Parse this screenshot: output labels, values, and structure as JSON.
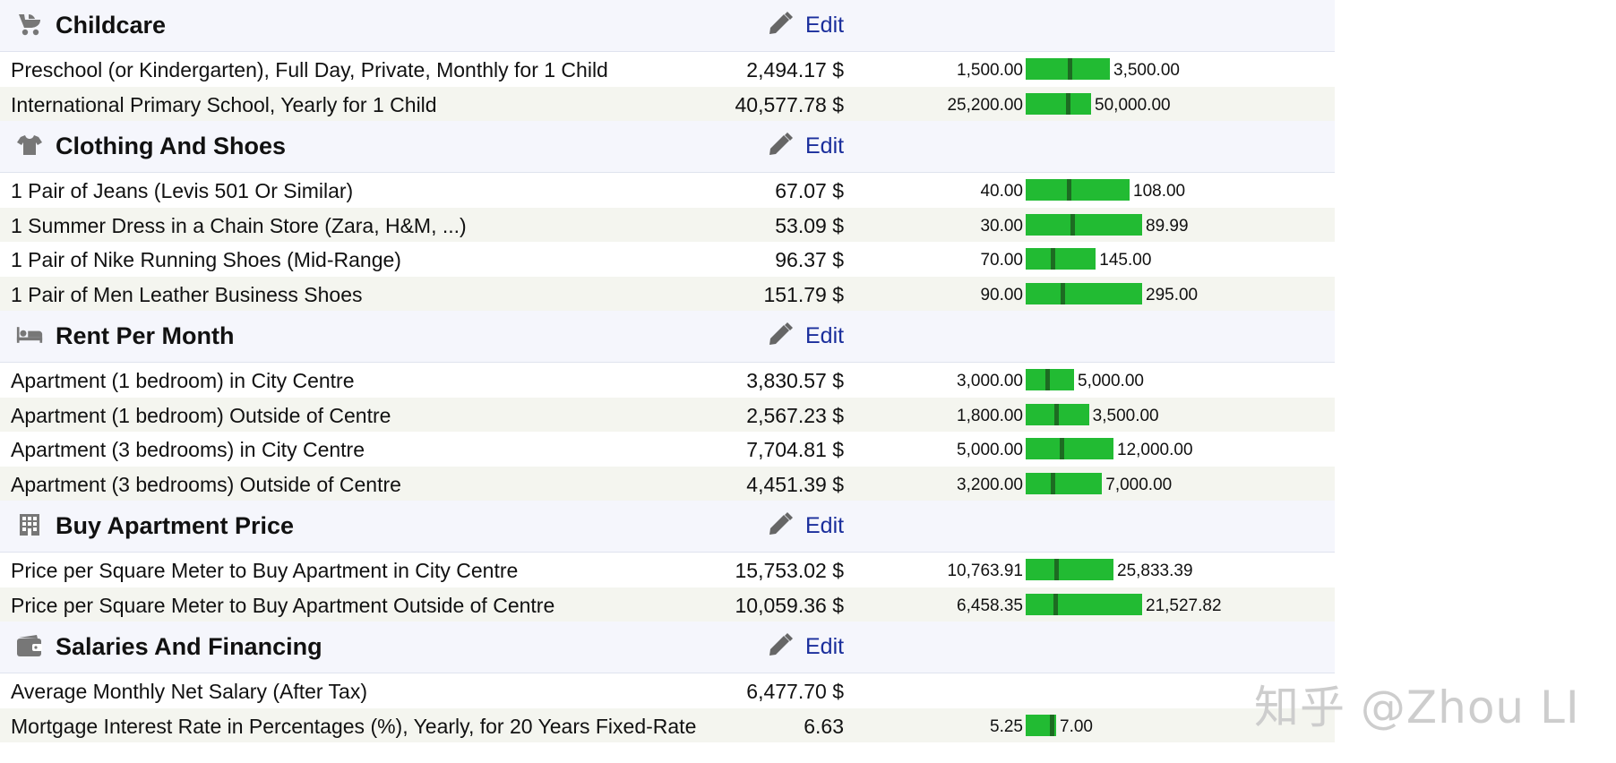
{
  "categories": [
    {
      "key": "childcare",
      "title": "Childcare",
      "icon": "stroller-icon",
      "edit_label": "Edit",
      "items": [
        {
          "name": "Preschool (or Kindergarten), Full Day, Private, Monthly for 1 Child",
          "price": "2,494.17 $",
          "min": "1,500.00",
          "max": "3,500.00",
          "min_v": 1500,
          "max_v": 3500,
          "v": 2494.17
        },
        {
          "name": "International Primary School, Yearly for 1 Child",
          "price": "40,577.78 $",
          "min": "25,200.00",
          "max": "50,000.00",
          "min_v": 25200,
          "max_v": 50000,
          "v": 40577.78
        }
      ]
    },
    {
      "key": "clothing",
      "title": "Clothing And Shoes",
      "icon": "tshirt-icon",
      "edit_label": "Edit",
      "items": [
        {
          "name": "1 Pair of Jeans (Levis 501 Or Similar)",
          "price": "67.07 $",
          "min": "40.00",
          "max": "108.00",
          "min_v": 40,
          "max_v": 108,
          "v": 67.07
        },
        {
          "name": "1 Summer Dress in a Chain Store (Zara, H&M, ...)",
          "price": "53.09 $",
          "min": "30.00",
          "max": "89.99",
          "min_v": 30,
          "max_v": 89.99,
          "v": 53.09
        },
        {
          "name": "1 Pair of Nike Running Shoes (Mid-Range)",
          "price": "96.37 $",
          "min": "70.00",
          "max": "145.00",
          "min_v": 70,
          "max_v": 145,
          "v": 96.37
        },
        {
          "name": "1 Pair of Men Leather Business Shoes",
          "price": "151.79 $",
          "min": "90.00",
          "max": "295.00",
          "min_v": 90,
          "max_v": 295,
          "v": 151.79
        }
      ]
    },
    {
      "key": "rent",
      "title": "Rent Per Month",
      "icon": "bed-icon",
      "edit_label": "Edit",
      "items": [
        {
          "name": "Apartment (1 bedroom) in City Centre",
          "price": "3,830.57 $",
          "min": "3,000.00",
          "max": "5,000.00",
          "min_v": 3000,
          "max_v": 5000,
          "v": 3830.57
        },
        {
          "name": "Apartment (1 bedroom) Outside of Centre",
          "price": "2,567.23 $",
          "min": "1,800.00",
          "max": "3,500.00",
          "min_v": 1800,
          "max_v": 3500,
          "v": 2567.23
        },
        {
          "name": "Apartment (3 bedrooms) in City Centre",
          "price": "7,704.81 $",
          "min": "5,000.00",
          "max": "12,000.00",
          "min_v": 5000,
          "max_v": 12000,
          "v": 7704.81
        },
        {
          "name": "Apartment (3 bedrooms) Outside of Centre",
          "price": "4,451.39 $",
          "min": "3,200.00",
          "max": "7,000.00",
          "min_v": 3200,
          "max_v": 7000,
          "v": 4451.39
        }
      ]
    },
    {
      "key": "buy",
      "title": "Buy Apartment Price",
      "icon": "building-icon",
      "edit_label": "Edit",
      "items": [
        {
          "name": "Price per Square Meter to Buy Apartment in City Centre",
          "price": "15,753.02 $",
          "min": "10,763.91",
          "max": "25,833.39",
          "min_v": 10763.91,
          "max_v": 25833.39,
          "v": 15753.02
        },
        {
          "name": "Price per Square Meter to Buy Apartment Outside of Centre",
          "price": "10,059.36 $",
          "min": "6,458.35",
          "max": "21,527.82",
          "min_v": 6458.35,
          "max_v": 21527.82,
          "v": 10059.36
        }
      ]
    },
    {
      "key": "salaries",
      "title": "Salaries And Financing",
      "icon": "wallet-icon",
      "edit_label": "Edit",
      "items": [
        {
          "name": "Average Monthly Net Salary (After Tax)",
          "price": "6,477.70 $",
          "min": "",
          "max": "",
          "min_v": null,
          "max_v": null,
          "v": null
        },
        {
          "name": "Mortgage Interest Rate in Percentages (%), Yearly, for 20 Years Fixed-Rate",
          "price": "6.63",
          "min": "5.25",
          "max": "7.00",
          "min_v": 5.25,
          "max_v": 7.0,
          "v": 6.63
        }
      ]
    }
  ],
  "watermark": "知乎 @Zhou LI",
  "colors": {
    "bar": "#22bb33",
    "marker": "#1d6b22",
    "edit": "#1a2e9c"
  }
}
